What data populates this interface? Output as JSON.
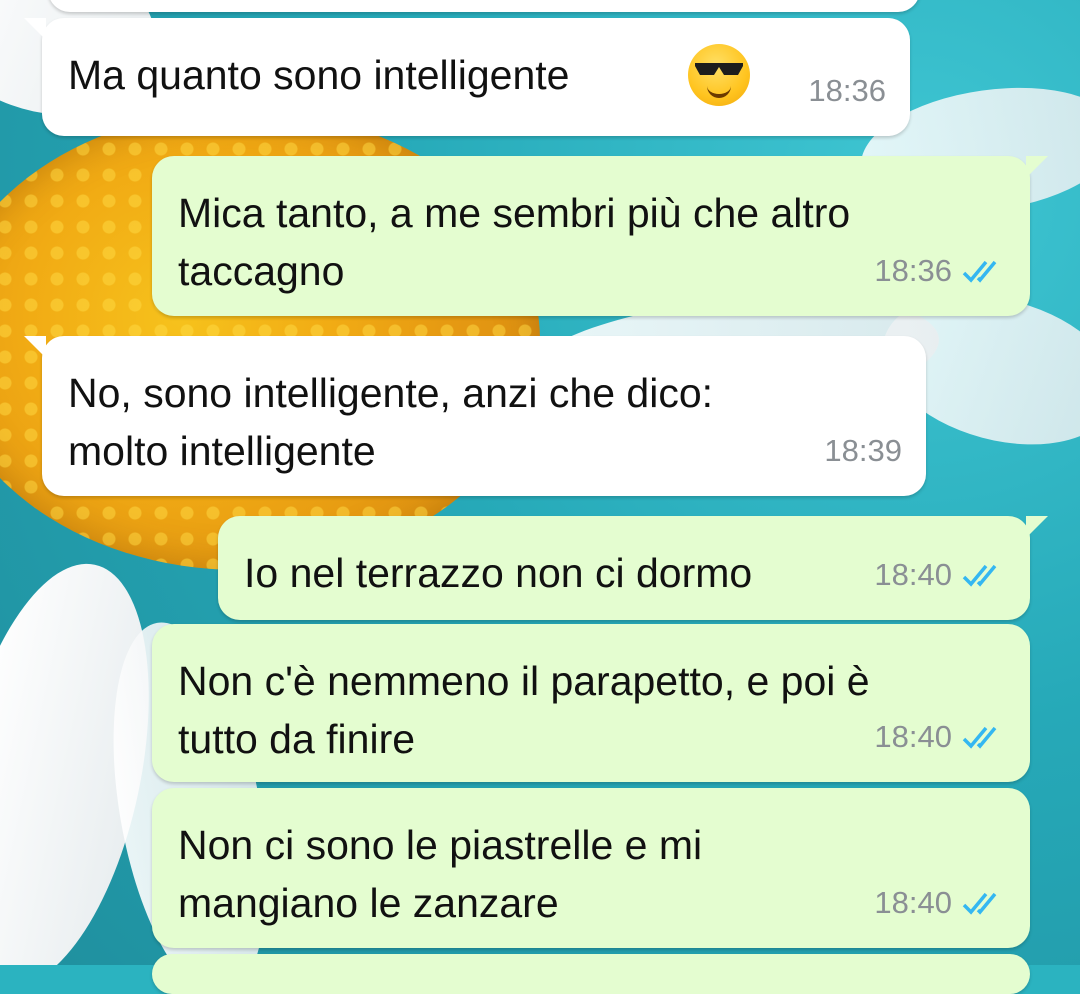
{
  "messages": [
    {
      "direction": "incoming",
      "text": "Ma quanto sono intelligente",
      "emoji": "smiling-face-with-sunglasses",
      "time": "18:36"
    },
    {
      "direction": "outgoing",
      "text": "Mica tanto, a me sembri più che altro\ntaccagno",
      "time": "18:36",
      "status": "read"
    },
    {
      "direction": "incoming",
      "text": "No, sono intelligente, anzi che dico:\nmolto intelligente",
      "time": "18:39"
    },
    {
      "direction": "outgoing",
      "text": "Io nel terrazzo non ci dormo",
      "time": "18:40",
      "status": "read"
    },
    {
      "direction": "outgoing",
      "text": "Non c'è nemmeno il parapetto, e poi è\ntutto da finire",
      "time": "18:40",
      "status": "read"
    },
    {
      "direction": "outgoing",
      "text": "Non ci sono le piastrelle e mi\nmangiano le zanzare",
      "time": "18:40",
      "status": "read"
    }
  ],
  "colors": {
    "incoming_bubble": "#ffffff",
    "outgoing_bubble": "#e4fdd0",
    "read_ticks": "#34b7f1",
    "timestamp": "#8a8f94"
  },
  "icons": {
    "read_receipt": "double-check-icon"
  }
}
